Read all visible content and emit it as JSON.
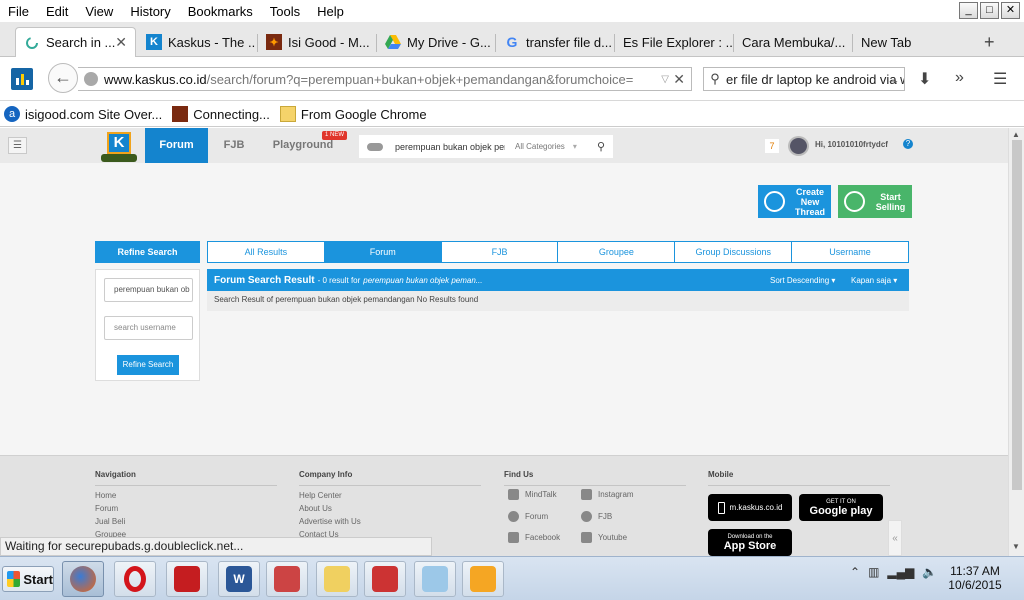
{
  "menubar": {
    "items": [
      "File",
      "Edit",
      "View",
      "History",
      "Bookmarks",
      "Tools",
      "Help"
    ],
    "window_controls": [
      "_",
      "□",
      "✕"
    ]
  },
  "tabs": [
    {
      "title": "Search in ...",
      "icon": "loading-icon"
    },
    {
      "title": "Kaskus - The ...",
      "icon": "kaskus-icon"
    },
    {
      "title": "Isi Good - M...",
      "icon": "isigood-icon"
    },
    {
      "title": "My Drive - G...",
      "icon": "google-drive-icon"
    },
    {
      "title": "transfer file d...",
      "icon": "google-icon"
    },
    {
      "title": "Es File Explorer : ...",
      "icon": ""
    },
    {
      "title": "Cara Membuka/...",
      "icon": ""
    },
    {
      "title": "New Tab",
      "icon": ""
    }
  ],
  "navbar": {
    "url_host": "www.kaskus.co.id",
    "url_rest": "/search/forum?q=perempuan+bukan+objek+pemandangan&forumchoice=",
    "search_text": "er file dr laptop ke android via w"
  },
  "bookmarks": [
    {
      "label": "isigood.com Site Over..."
    },
    {
      "label": "Connecting..."
    },
    {
      "label": "From Google Chrome"
    }
  ],
  "kaskus": {
    "nav": {
      "forum": "Forum",
      "fjb": "FJB",
      "playground": "Playground",
      "new_badge": "1 NEW"
    },
    "search": {
      "query": "perempuan bukan objek peman",
      "category": "All Categories"
    },
    "notif_count": "7",
    "greeting": "Hi, 10101010frtydcf",
    "cta": {
      "create": "Create New Thread",
      "sell": "Start Selling"
    },
    "refine": {
      "title": "Refine Search",
      "query_value": "perempuan bukan ob",
      "username_placeholder": "search username",
      "button": "Refine Search"
    },
    "search_tabs": [
      "All Results",
      "Forum",
      "FJB",
      "Groupee",
      "Group Discussions",
      "Username"
    ],
    "active_tab": "Forum",
    "result": {
      "title": "Forum Search Result",
      "summary": "- 0 result for",
      "query": "perempuan bukan objek peman...",
      "sort": "Sort Descending",
      "time": "Kapan saja",
      "message": "Search Result of perempuan bukan objek pemandangan No Results found"
    },
    "footer": {
      "navigation": {
        "title": "Navigation",
        "links": [
          "Home",
          "Forum",
          "Jual Beli",
          "Groupee"
        ]
      },
      "company": {
        "title": "Company Info",
        "links": [
          "Help Center",
          "About Us",
          "Advertise with Us",
          "Contact Us"
        ]
      },
      "findus": {
        "title": "Find Us",
        "items": [
          "MindTalk",
          "Instagram",
          "Forum",
          "FJB",
          "Facebook",
          "Youtube"
        ]
      },
      "mobile": {
        "title": "Mobile",
        "site": "m.kaskus.co.id",
        "gp_small": "GET IT ON",
        "gp_big": "Google play",
        "as_small": "Download on the",
        "as_big": "App Store"
      }
    }
  },
  "status_text": "Waiting for securepubads.g.doubleclick.net...",
  "taskbar": {
    "start": "Start",
    "time": "11:37 AM",
    "date": "10/6/2015"
  },
  "colors": {
    "kaskus_blue": "#1484ce",
    "sell_green": "#49b56a",
    "tab_active": "#1b94dd"
  }
}
